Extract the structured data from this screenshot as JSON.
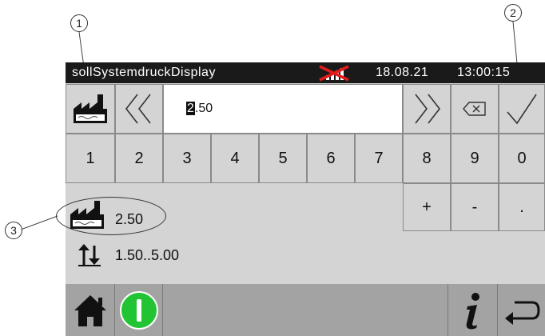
{
  "callouts": {
    "c1": "1",
    "c2": "2",
    "c3": "3"
  },
  "header": {
    "title": "sollSystemdruckDisplay",
    "date": "18.08.21",
    "time": "13:00:15"
  },
  "input": {
    "value_selected": "2",
    "value_rest": ".50"
  },
  "keypad": {
    "digits": [
      "1",
      "2",
      "3",
      "4",
      "5",
      "6",
      "7",
      "8",
      "9",
      "0"
    ],
    "plus": "+",
    "minus": "-",
    "dot": "."
  },
  "info": {
    "current_value": "2.50",
    "range": "1.50..5.00"
  },
  "colors": {
    "title_bg": "#1a1a1a",
    "panel_bg": "#d4d4d4",
    "bottom_bg": "#a3a3a3",
    "power_green": "#22c433",
    "signal_cross": "#e21b1b"
  },
  "icons": [
    "factory-icon",
    "double-chevron-left-icon",
    "double-chevron-right-icon",
    "backspace-icon",
    "checkmark-icon",
    "signal-crossed-icon",
    "range-arrows-icon",
    "home-icon",
    "power-icon",
    "info-icon",
    "return-icon"
  ]
}
